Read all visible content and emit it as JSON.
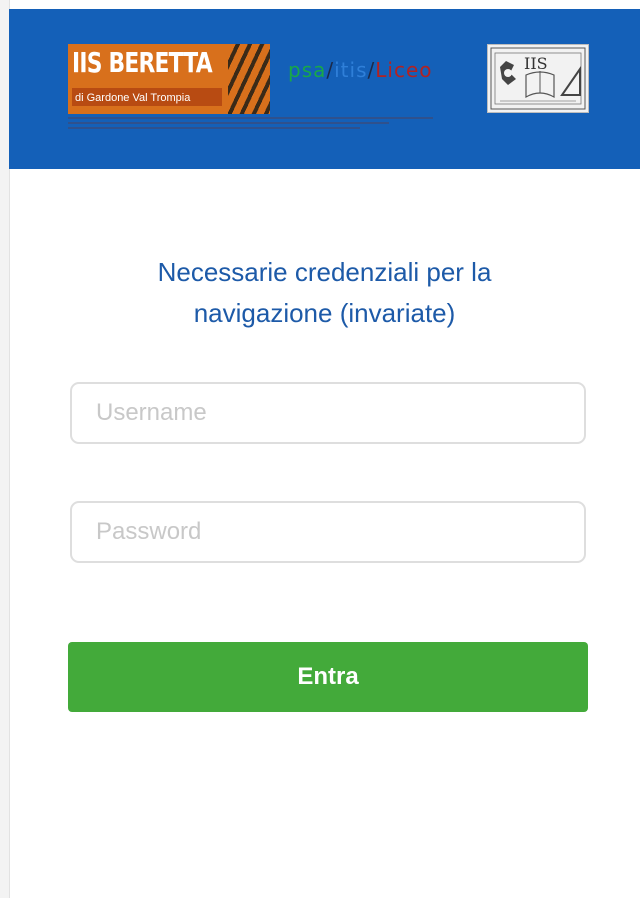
{
  "header": {
    "logo_beretta": {
      "title": "IIS BERETTA",
      "subtitle": "di Gardone Val Trompia"
    },
    "logo_schools": {
      "part1": "psa",
      "sep1": "/",
      "part2": "itis",
      "sep2": "/",
      "part3": "Liceo"
    },
    "logo_iis": {
      "text": "IIS"
    }
  },
  "form": {
    "heading_line1": "Necessarie credenziali per la",
    "heading_line2": "navigazione (invariate)",
    "username_placeholder": "Username",
    "password_placeholder": "Password",
    "submit_label": "Entra"
  },
  "colors": {
    "header_bg": "#1460b8",
    "heading": "#1d5aa8",
    "button_bg": "#43aa3a"
  }
}
